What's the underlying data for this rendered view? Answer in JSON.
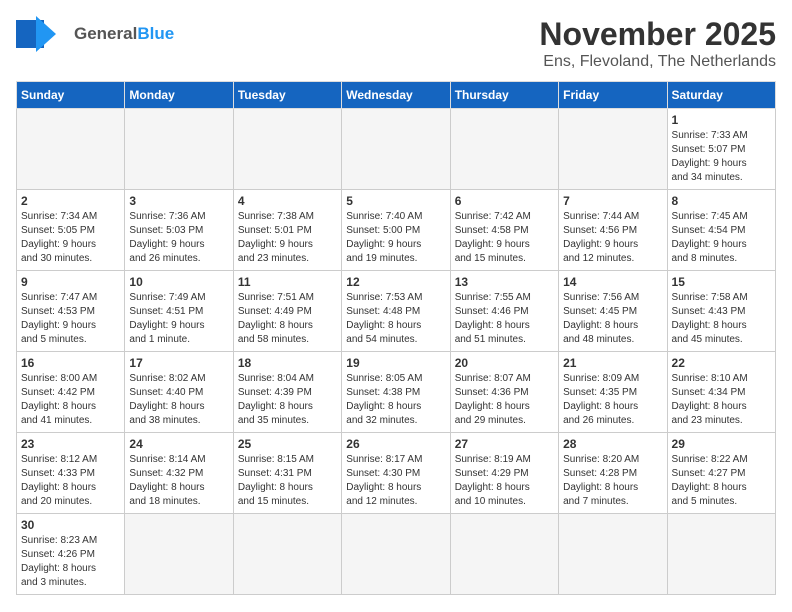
{
  "logo": {
    "text_general": "General",
    "text_blue": "Blue"
  },
  "title": "November 2025",
  "subtitle": "Ens, Flevoland, The Netherlands",
  "weekdays": [
    "Sunday",
    "Monday",
    "Tuesday",
    "Wednesday",
    "Thursday",
    "Friday",
    "Saturday"
  ],
  "days": [
    {
      "num": "",
      "info": ""
    },
    {
      "num": "",
      "info": ""
    },
    {
      "num": "",
      "info": ""
    },
    {
      "num": "",
      "info": ""
    },
    {
      "num": "",
      "info": ""
    },
    {
      "num": "",
      "info": ""
    },
    {
      "num": "1",
      "info": "Sunrise: 7:33 AM\nSunset: 5:07 PM\nDaylight: 9 hours\nand 34 minutes."
    },
    {
      "num": "2",
      "info": "Sunrise: 7:34 AM\nSunset: 5:05 PM\nDaylight: 9 hours\nand 30 minutes."
    },
    {
      "num": "3",
      "info": "Sunrise: 7:36 AM\nSunset: 5:03 PM\nDaylight: 9 hours\nand 26 minutes."
    },
    {
      "num": "4",
      "info": "Sunrise: 7:38 AM\nSunset: 5:01 PM\nDaylight: 9 hours\nand 23 minutes."
    },
    {
      "num": "5",
      "info": "Sunrise: 7:40 AM\nSunset: 5:00 PM\nDaylight: 9 hours\nand 19 minutes."
    },
    {
      "num": "6",
      "info": "Sunrise: 7:42 AM\nSunset: 4:58 PM\nDaylight: 9 hours\nand 15 minutes."
    },
    {
      "num": "7",
      "info": "Sunrise: 7:44 AM\nSunset: 4:56 PM\nDaylight: 9 hours\nand 12 minutes."
    },
    {
      "num": "8",
      "info": "Sunrise: 7:45 AM\nSunset: 4:54 PM\nDaylight: 9 hours\nand 8 minutes."
    },
    {
      "num": "9",
      "info": "Sunrise: 7:47 AM\nSunset: 4:53 PM\nDaylight: 9 hours\nand 5 minutes."
    },
    {
      "num": "10",
      "info": "Sunrise: 7:49 AM\nSunset: 4:51 PM\nDaylight: 9 hours\nand 1 minute."
    },
    {
      "num": "11",
      "info": "Sunrise: 7:51 AM\nSunset: 4:49 PM\nDaylight: 8 hours\nand 58 minutes."
    },
    {
      "num": "12",
      "info": "Sunrise: 7:53 AM\nSunset: 4:48 PM\nDaylight: 8 hours\nand 54 minutes."
    },
    {
      "num": "13",
      "info": "Sunrise: 7:55 AM\nSunset: 4:46 PM\nDaylight: 8 hours\nand 51 minutes."
    },
    {
      "num": "14",
      "info": "Sunrise: 7:56 AM\nSunset: 4:45 PM\nDaylight: 8 hours\nand 48 minutes."
    },
    {
      "num": "15",
      "info": "Sunrise: 7:58 AM\nSunset: 4:43 PM\nDaylight: 8 hours\nand 45 minutes."
    },
    {
      "num": "16",
      "info": "Sunrise: 8:00 AM\nSunset: 4:42 PM\nDaylight: 8 hours\nand 41 minutes."
    },
    {
      "num": "17",
      "info": "Sunrise: 8:02 AM\nSunset: 4:40 PM\nDaylight: 8 hours\nand 38 minutes."
    },
    {
      "num": "18",
      "info": "Sunrise: 8:04 AM\nSunset: 4:39 PM\nDaylight: 8 hours\nand 35 minutes."
    },
    {
      "num": "19",
      "info": "Sunrise: 8:05 AM\nSunset: 4:38 PM\nDaylight: 8 hours\nand 32 minutes."
    },
    {
      "num": "20",
      "info": "Sunrise: 8:07 AM\nSunset: 4:36 PM\nDaylight: 8 hours\nand 29 minutes."
    },
    {
      "num": "21",
      "info": "Sunrise: 8:09 AM\nSunset: 4:35 PM\nDaylight: 8 hours\nand 26 minutes."
    },
    {
      "num": "22",
      "info": "Sunrise: 8:10 AM\nSunset: 4:34 PM\nDaylight: 8 hours\nand 23 minutes."
    },
    {
      "num": "23",
      "info": "Sunrise: 8:12 AM\nSunset: 4:33 PM\nDaylight: 8 hours\nand 20 minutes."
    },
    {
      "num": "24",
      "info": "Sunrise: 8:14 AM\nSunset: 4:32 PM\nDaylight: 8 hours\nand 18 minutes."
    },
    {
      "num": "25",
      "info": "Sunrise: 8:15 AM\nSunset: 4:31 PM\nDaylight: 8 hours\nand 15 minutes."
    },
    {
      "num": "26",
      "info": "Sunrise: 8:17 AM\nSunset: 4:30 PM\nDaylight: 8 hours\nand 12 minutes."
    },
    {
      "num": "27",
      "info": "Sunrise: 8:19 AM\nSunset: 4:29 PM\nDaylight: 8 hours\nand 10 minutes."
    },
    {
      "num": "28",
      "info": "Sunrise: 8:20 AM\nSunset: 4:28 PM\nDaylight: 8 hours\nand 7 minutes."
    },
    {
      "num": "29",
      "info": "Sunrise: 8:22 AM\nSunset: 4:27 PM\nDaylight: 8 hours\nand 5 minutes."
    },
    {
      "num": "30",
      "info": "Sunrise: 8:23 AM\nSunset: 4:26 PM\nDaylight: 8 hours\nand 3 minutes."
    },
    {
      "num": "",
      "info": ""
    },
    {
      "num": "",
      "info": ""
    },
    {
      "num": "",
      "info": ""
    },
    {
      "num": "",
      "info": ""
    },
    {
      "num": "",
      "info": ""
    },
    {
      "num": "",
      "info": ""
    }
  ]
}
